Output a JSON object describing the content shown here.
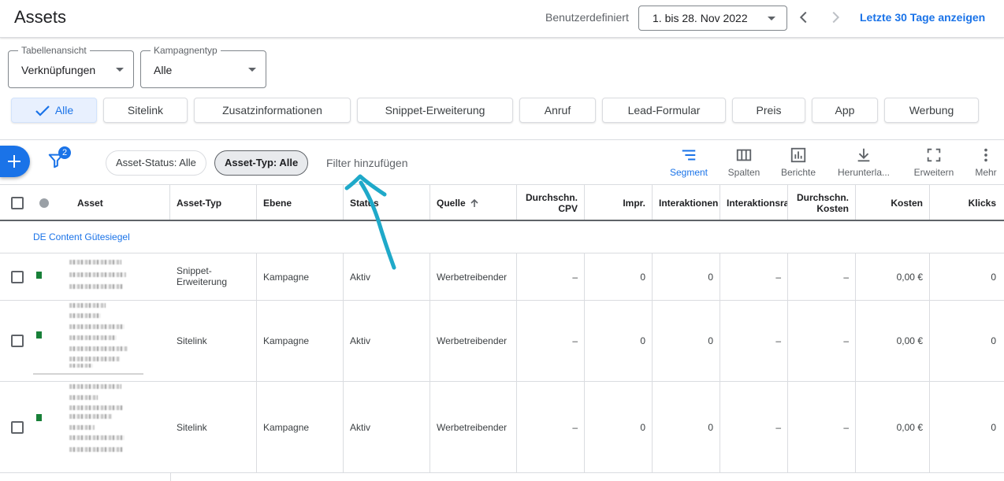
{
  "header": {
    "title": "Assets",
    "daterange_label": "Benutzerdefiniert",
    "daterange_value": "1. bis 28. Nov 2022",
    "last30_link": "Letzte 30 Tage anzeigen"
  },
  "filters": {
    "table_view": {
      "legend": "Tabellenansicht",
      "value": "Verknüpfungen"
    },
    "campaign_type": {
      "legend": "Kampagnentyp",
      "value": "Alle"
    }
  },
  "chips": [
    "Alle",
    "Sitelink",
    "Zusatzinformationen",
    "Snippet-Erweiterung",
    "Anruf",
    "Lead-Formular",
    "Preis",
    "App",
    "Werbung"
  ],
  "toolbar": {
    "filter_count": "2",
    "pill_status": "Asset-Status: Alle",
    "pill_type": "Asset-Typ: Alle",
    "add_filter": "Filter hinzufügen",
    "tools": [
      "Segment",
      "Spalten",
      "Berichte",
      "Herunterla...",
      "Erweitern",
      "Mehr"
    ]
  },
  "table": {
    "columns": {
      "asset": "Asset",
      "asset_type": "Asset-Typ",
      "level": "Ebene",
      "status": "Status",
      "source": "Quelle",
      "avg_cpv_1": "Durchschn.",
      "avg_cpv_2": "CPV",
      "impr": "Impr.",
      "interactions": "Interaktionen",
      "interaction_rate": "Interaktionsrate",
      "avg_cost_1": "Durchschn.",
      "avg_cost_2": "Kosten",
      "cost": "Kosten",
      "clicks": "Klicks"
    },
    "group": "DE Content Gütesiegel",
    "rows": [
      {
        "asset_type": "Snippet-Erweiterung",
        "level": "Kampagne",
        "status": "Aktiv",
        "source": "Werbetreibender",
        "avg_cpv": "–",
        "impr": "0",
        "interactions": "0",
        "interaction_rate": "–",
        "avg_cost": "–",
        "cost": "0,00 €",
        "clicks": "0"
      },
      {
        "asset_type": "Sitelink",
        "level": "Kampagne",
        "status": "Aktiv",
        "source": "Werbetreibender",
        "avg_cpv": "–",
        "impr": "0",
        "interactions": "0",
        "interaction_rate": "–",
        "avg_cost": "–",
        "cost": "0,00 €",
        "clicks": "0"
      },
      {
        "asset_type": "Sitelink",
        "level": "Kampagne",
        "status": "Aktiv",
        "source": "Werbetreibender",
        "avg_cpv": "–",
        "impr": "0",
        "interactions": "0",
        "interaction_rate": "–",
        "avg_cost": "–",
        "cost": "0,00 €",
        "clicks": "0"
      }
    ]
  },
  "colors": {
    "accent": "#1a73e8",
    "arrow": "#1fa9c9",
    "status_green": "#188038"
  }
}
